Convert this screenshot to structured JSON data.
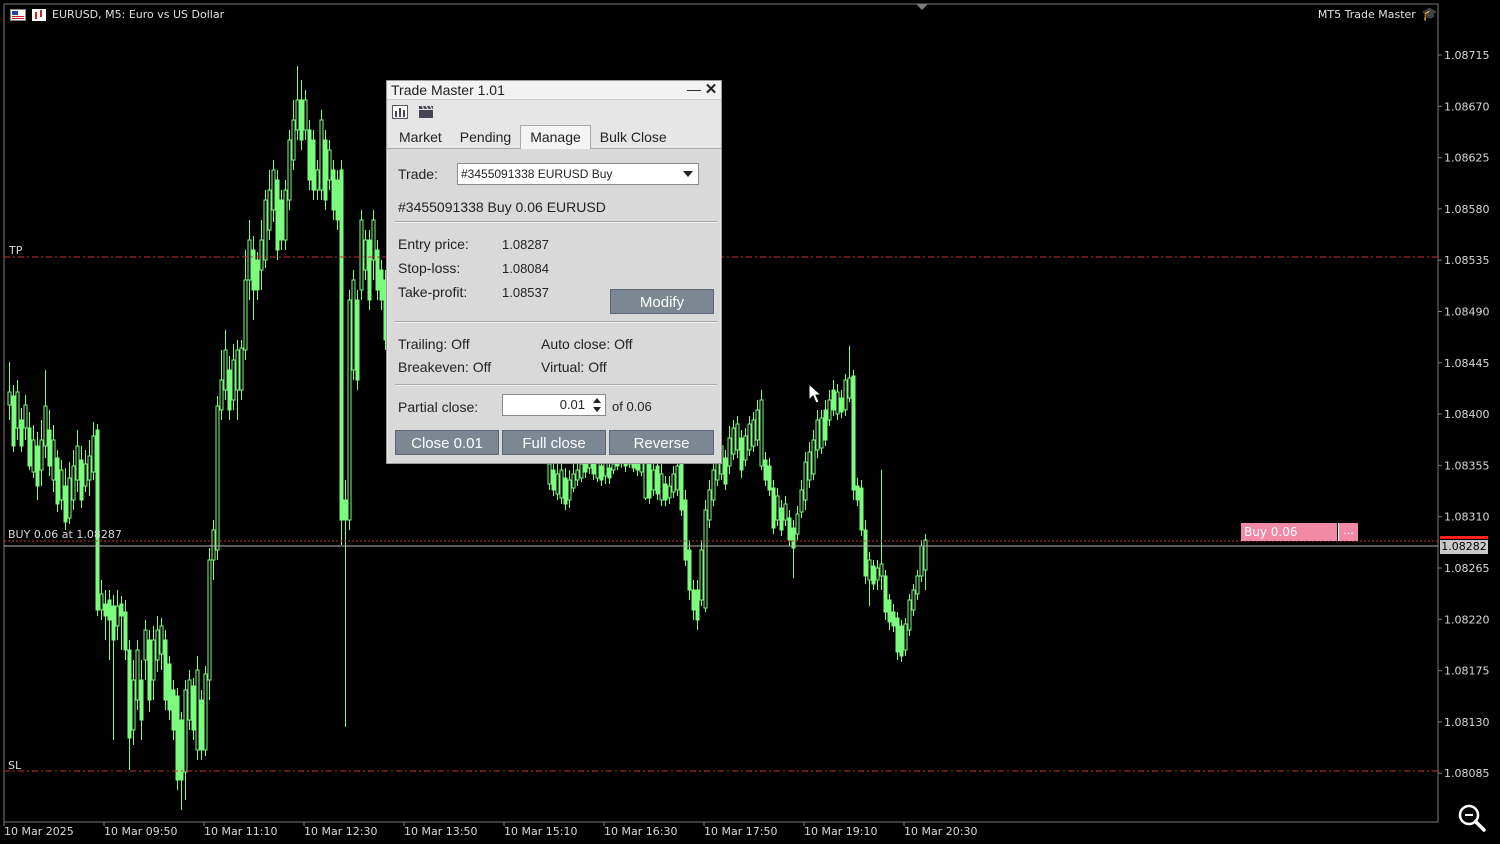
{
  "chart": {
    "symbol_title": "EURUSD, M5:  Euro vs US Dollar",
    "ea_name": "MT5 Trade Master",
    "price_axis": [
      "1.08715",
      "1.08670",
      "1.08625",
      "1.08580",
      "1.08535",
      "1.08490",
      "1.08445",
      "1.08400",
      "1.08355",
      "1.08310",
      "1.08265",
      "1.08220",
      "1.08175",
      "1.08130",
      "1.08085"
    ],
    "time_axis": [
      "10 Mar 2025",
      "10 Mar 09:50",
      "10 Mar 11:10",
      "10 Mar 12:30",
      "10 Mar 13:50",
      "10 Mar 15:10",
      "10 Mar 16:30",
      "10 Mar 17:50",
      "10 Mar 19:10",
      "10 Mar 20:30"
    ],
    "tp_label": "TP",
    "sl_label": "SL",
    "entry_label": "BUY 0.06 at 1.08287",
    "current_price": "1.08282",
    "position_label": "Buy 0.06",
    "position_menu": "...",
    "colors": {
      "candle": "#7cfc7c",
      "level": "#c83232",
      "bid": "#b4b4b4"
    }
  },
  "panel": {
    "title": "Trade Master 1.01",
    "minimize": "—",
    "close": "✕",
    "tabs": [
      "Market",
      "Pending",
      "Manage",
      "Bulk Close"
    ],
    "active_tab": "Manage",
    "trade_label": "Trade:",
    "trade_selected": "#3455091338 EURUSD Buy",
    "trade_summary": "#3455091338   Buy 0.06 EURUSD",
    "entry_label": "Entry price:",
    "entry_value": "1.08287",
    "sl_label": "Stop-loss:",
    "sl_value": "1.08084",
    "tp_label": "Take-profit:",
    "tp_value": "1.08537",
    "modify_button": "Modify",
    "trailing": "Trailing: Off",
    "auto_close": "Auto close: Off",
    "breakeven": "Breakeven: Off",
    "virtual": "Virtual: Off",
    "partial_label": "Partial close:",
    "partial_value": "0.01",
    "partial_of": "of 0.06",
    "close_button": "Close 0.01",
    "full_close_button": "Full close",
    "reverse_button": "Reverse"
  }
}
